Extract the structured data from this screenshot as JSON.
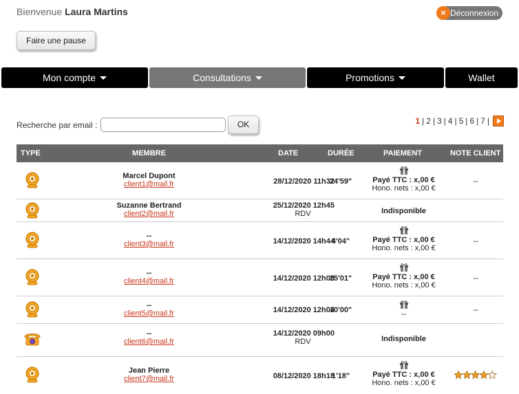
{
  "header": {
    "welcome_prefix": "Bienvenue",
    "user_name": "Laura Martins",
    "logout_label": "Déconnexion",
    "pause_label": "Faire une pause"
  },
  "nav": {
    "items": [
      {
        "label": "Mon compte",
        "dropdown": true
      },
      {
        "label": "Consultations",
        "dropdown": true,
        "active": true
      },
      {
        "label": "Promotions",
        "dropdown": true
      },
      {
        "label": "Wallet",
        "dropdown": false
      }
    ]
  },
  "search": {
    "label": "Recherche par email :",
    "value": "",
    "placeholder": "",
    "ok_label": "OK"
  },
  "pagination": {
    "current": "1",
    "pages": [
      "2",
      "3",
      "4",
      "5",
      "6",
      "7"
    ]
  },
  "table": {
    "headers": {
      "type": "TYPE",
      "member": "MEMBRE",
      "date": "DATE",
      "duration": "DURÉE",
      "payment": "PAIEMENT",
      "note": "NOTE CLIENT"
    },
    "rows": [
      {
        "type": "webcam-icon",
        "name": "Marcel Dupont",
        "email": "client1@mail.fr",
        "date": "28/12/2020 11h32",
        "date_sub": "",
        "duration": "24'59\"",
        "pay_ttc_label": "Payé TTC :",
        "pay_ttc_value": "x,00 €",
        "pay_hono": "Hono. nets : x,00 €",
        "note": "--"
      },
      {
        "type": "webcam-icon",
        "name": "Suzanne Bertrand",
        "email": "client2@mail.fr",
        "date": "25/12/2020 12h45",
        "date_sub": "RDV",
        "duration": "",
        "payment_status": "Indisponible",
        "note": ""
      },
      {
        "type": "webcam-icon",
        "name": "--",
        "email": "client3@mail.fr",
        "date": "14/12/2020 14h44",
        "date_sub": "",
        "duration": "4'04\"",
        "pay_ttc_label": "Payé TTC :",
        "pay_ttc_value": "x,00 €",
        "pay_hono": "Hono. nets : x,00 €",
        "note": "--"
      },
      {
        "type": "webcam-icon",
        "name": "--",
        "email": "client4@mail.fr",
        "date": "14/12/2020 12h08",
        "date_sub": "",
        "duration": "25'01\"",
        "pay_ttc_label": "Payé TTC :",
        "pay_ttc_value": "x,00 €",
        "pay_hono": "Hono. nets : x,00 €",
        "note": "--"
      },
      {
        "type": "webcam-icon",
        "name": "--",
        "email": "client5@mail.fr",
        "date": "14/12/2020 12h04",
        "date_sub": "",
        "duration": "10'00\"",
        "pay_dash": "--",
        "note": "--"
      },
      {
        "type": "phone-icon",
        "name": "--",
        "email": "client6@mail.fr",
        "date": "14/12/2020 09h00",
        "date_sub": "RDV",
        "duration": "",
        "payment_status": "Indisponible",
        "note": ""
      },
      {
        "type": "webcam-icon",
        "name": "Jean Pierre",
        "email": "client7@mail.fr",
        "date": "08/12/2020 18h18",
        "date_sub": "",
        "duration": "1'18\"",
        "pay_ttc_label": "Payé TTC :",
        "pay_ttc_value": "x,00 €",
        "pay_hono": "Hono. nets : x,00 €",
        "note_stars": 4
      }
    ]
  },
  "colors": {
    "accent_orange": "#f07a1a",
    "email_red": "#c8341a",
    "nav_black": "#000000",
    "nav_active": "#767676",
    "table_header": "#666666"
  }
}
